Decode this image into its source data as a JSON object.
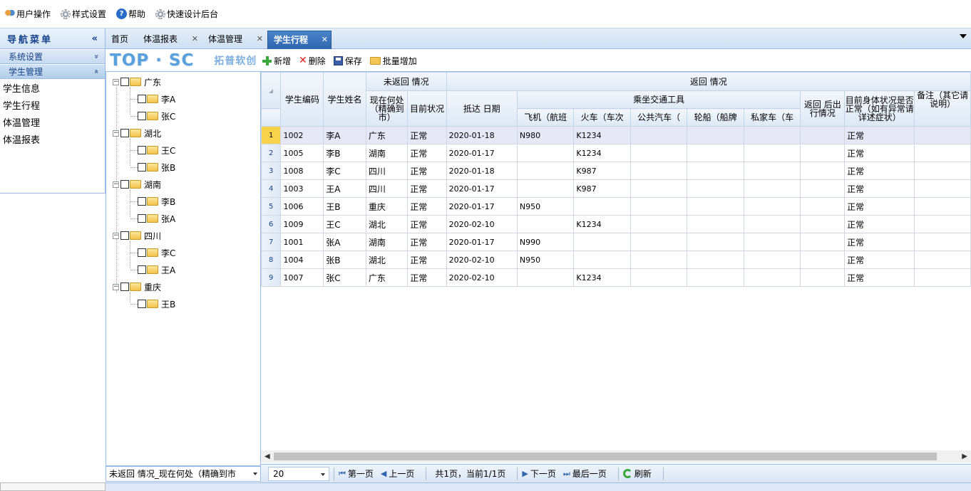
{
  "topbar": {
    "user_ops": "用户操作",
    "style_settings": "样式设置",
    "help": "帮助",
    "quick_design": "快速设计后台"
  },
  "sidebar": {
    "title": "导航菜单",
    "collapse_symbol": "«",
    "groups": [
      {
        "label": "系统设置",
        "toggle": "»"
      },
      {
        "label": "学生管理",
        "toggle": "«"
      }
    ],
    "items": [
      "学生信息",
      "学生行程",
      "体温管理",
      "体温报表"
    ]
  },
  "tabs": [
    {
      "label": "首页",
      "closable": false
    },
    {
      "label": "体温报表",
      "closable": true
    },
    {
      "label": "体温管理",
      "closable": true
    },
    {
      "label": "学生行程",
      "closable": true,
      "active": true
    }
  ],
  "logo": {
    "brand": "TOP · SC",
    "subtitle": "拓普软创"
  },
  "toolbar": {
    "add": "新增",
    "delete": "删除",
    "save": "保存",
    "batch_add": "批量增加"
  },
  "tree": {
    "provinces": [
      {
        "name": "广东",
        "students": [
          "李A",
          "张C"
        ]
      },
      {
        "name": "湖北",
        "students": [
          "王C",
          "张B"
        ]
      },
      {
        "name": "湖南",
        "students": [
          "李B",
          "张A"
        ]
      },
      {
        "name": "四川",
        "students": [
          "李C",
          "王A"
        ]
      },
      {
        "name": "重庆",
        "students": [
          "王B"
        ]
      }
    ],
    "filter_combo": "未返回   情况_现在何处（精确到市"
  },
  "grid": {
    "headers": {
      "student_id": "学生编码",
      "student_name": "学生姓名",
      "not_returned_group": "未返回   情况",
      "current_location": "现在何处（精确到市）",
      "current_status": "目前状况",
      "returned_group": "返回   情况",
      "arrival_date": "抵达   日期",
      "transport_group": "乘坐交通工具",
      "plane": "飞机（航班",
      "train": "火车（车次",
      "bus": "公共汽车（",
      "ship": "轮船（船牌",
      "private_car": "私家车（车",
      "travel_after_return": "返回   后出行情况",
      "health_status": "目前身体状况是否正常（如有异常请详述症状）",
      "remark": "备注（其它请说明）"
    },
    "rows": [
      {
        "n": "1",
        "id": "1002",
        "name": "李A",
        "loc": "广东",
        "status": "正常",
        "date": "2020-01-18",
        "plane": "N980",
        "train": "K1234",
        "bus": "",
        "ship": "",
        "car": "",
        "travel": "",
        "health": "正常",
        "remark": ""
      },
      {
        "n": "2",
        "id": "1005",
        "name": "李B",
        "loc": "湖南",
        "status": "正常",
        "date": "2020-01-17",
        "plane": "",
        "train": "K1234",
        "bus": "",
        "ship": "",
        "car": "",
        "travel": "",
        "health": "正常",
        "remark": ""
      },
      {
        "n": "3",
        "id": "1008",
        "name": "李C",
        "loc": "四川",
        "status": "正常",
        "date": "2020-01-18",
        "plane": "",
        "train": "K987",
        "bus": "",
        "ship": "",
        "car": "",
        "travel": "",
        "health": "正常",
        "remark": ""
      },
      {
        "n": "4",
        "id": "1003",
        "name": "王A",
        "loc": "四川",
        "status": "正常",
        "date": "2020-01-17",
        "plane": "",
        "train": "K987",
        "bus": "",
        "ship": "",
        "car": "",
        "travel": "",
        "health": "正常",
        "remark": ""
      },
      {
        "n": "5",
        "id": "1006",
        "name": "王B",
        "loc": "重庆",
        "status": "正常",
        "date": "2020-01-17",
        "plane": "N950",
        "train": "",
        "bus": "",
        "ship": "",
        "car": "",
        "travel": "",
        "health": "正常",
        "remark": ""
      },
      {
        "n": "6",
        "id": "1009",
        "name": "王C",
        "loc": "湖北",
        "status": "正常",
        "date": "2020-02-10",
        "plane": "",
        "train": "K1234",
        "bus": "",
        "ship": "",
        "car": "",
        "travel": "",
        "health": "正常",
        "remark": ""
      },
      {
        "n": "7",
        "id": "1001",
        "name": "张A",
        "loc": "湖南",
        "status": "正常",
        "date": "2020-01-17",
        "plane": "N990",
        "train": "",
        "bus": "",
        "ship": "",
        "car": "",
        "travel": "",
        "health": "正常",
        "remark": ""
      },
      {
        "n": "8",
        "id": "1004",
        "name": "张B",
        "loc": "湖北",
        "status": "正常",
        "date": "2020-02-10",
        "plane": "N950",
        "train": "",
        "bus": "",
        "ship": "",
        "car": "",
        "travel": "",
        "health": "正常",
        "remark": ""
      },
      {
        "n": "9",
        "id": "1007",
        "name": "张C",
        "loc": "广东",
        "status": "正常",
        "date": "2020-02-10",
        "plane": "",
        "train": "K1234",
        "bus": "",
        "ship": "",
        "car": "",
        "travel": "",
        "health": "正常",
        "remark": ""
      }
    ]
  },
  "pager": {
    "page_size": "20",
    "first": "第一页",
    "prev": "上一页",
    "info": "共1页，当前1/1页",
    "next": "下一页",
    "last": "最后一页",
    "refresh": "刷新"
  },
  "colors": {
    "accent": "#2f66b0",
    "border": "#99bbe8",
    "selected_row": "#e6e8f8",
    "selected_rownum": "#f8d24a"
  }
}
